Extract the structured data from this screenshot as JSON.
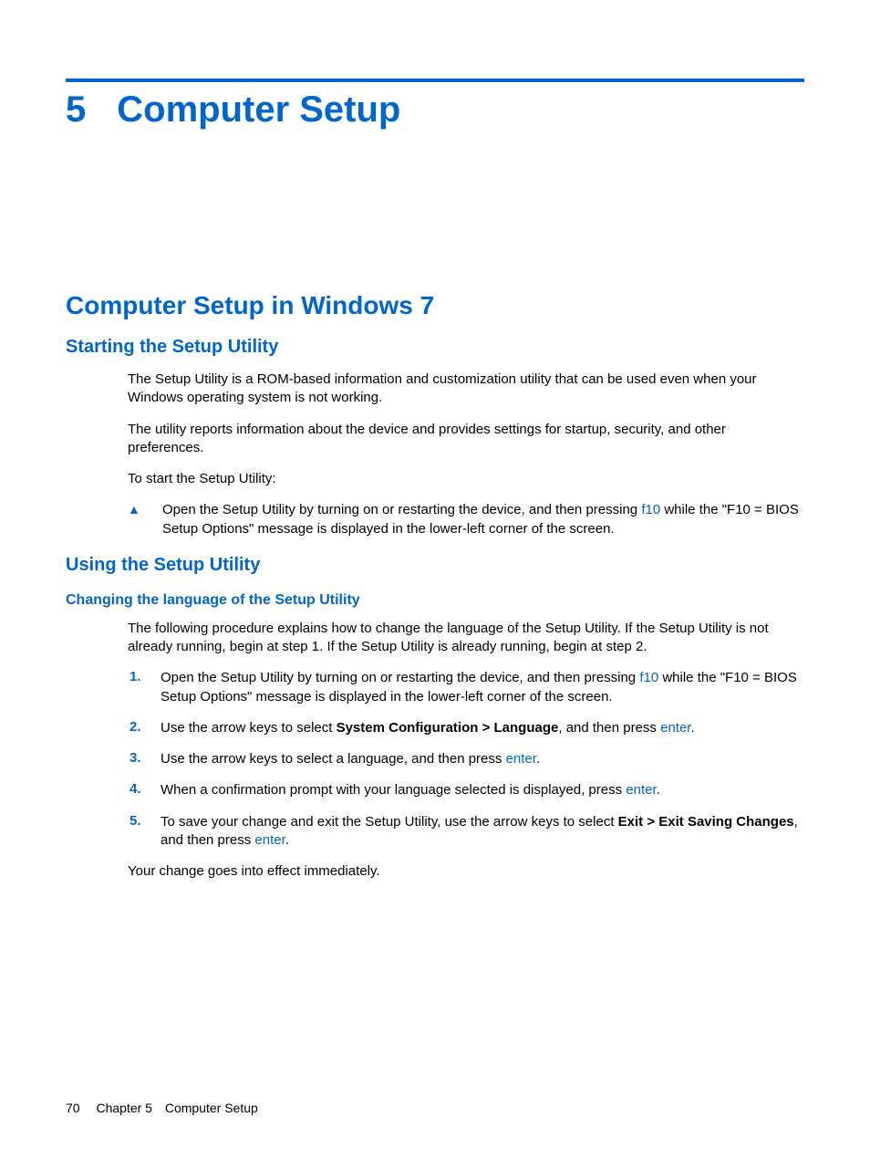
{
  "chapter": {
    "number": "5",
    "title": "Computer Setup"
  },
  "section": "Computer Setup in Windows 7",
  "sub1": {
    "title": "Starting the Setup Utility",
    "p1": "The Setup Utility is a ROM-based information and customization utility that can be used even when your Windows operating system is not working.",
    "p2": "The utility reports information about the device and provides settings for startup, security, and other preferences.",
    "p3": "To start the Setup Utility:",
    "bullet_pre": "Open the Setup Utility by turning on or restarting the device, and then pressing ",
    "bullet_key": "f10",
    "bullet_post": " while the \"F10 = BIOS Setup Options\" message is displayed in the lower-left corner of the screen."
  },
  "sub2": {
    "title": "Using the Setup Utility",
    "subsub": "Changing the language of the Setup Utility",
    "intro": "The following procedure explains how to change the language of the Setup Utility. If the Setup Utility is not already running, begin at step 1. If the Setup Utility is already running, begin at step 2.",
    "step1_pre": "Open the Setup Utility by turning on or restarting the device, and then pressing ",
    "step1_key": "f10",
    "step1_post": " while the \"F10 = BIOS Setup Options\" message is displayed in the lower-left corner of the screen.",
    "step2_pre": "Use the arrow keys to select ",
    "step2_bold": "System Configuration > Language",
    "step2_mid": ", and then press ",
    "step2_key": "enter",
    "step2_end": ".",
    "step3_pre": "Use the arrow keys to select a language, and then press ",
    "step3_key": "enter",
    "step3_end": ".",
    "step4_pre": "When a confirmation prompt with your language selected is displayed, press ",
    "step4_key": "enter",
    "step4_end": ".",
    "step5_pre": "To save your change and exit the Setup Utility, use the arrow keys to select ",
    "step5_bold": "Exit > Exit Saving Changes",
    "step5_mid": ", and then press ",
    "step5_key": "enter",
    "step5_end": ".",
    "outro": "Your change goes into effect immediately."
  },
  "nums": {
    "n1": "1.",
    "n2": "2.",
    "n3": "3.",
    "n4": "4.",
    "n5": "5."
  },
  "bullet_glyph": "▲",
  "footer": {
    "page": "70",
    "chapter_label": "Chapter 5",
    "chapter_title": "Computer Setup"
  }
}
